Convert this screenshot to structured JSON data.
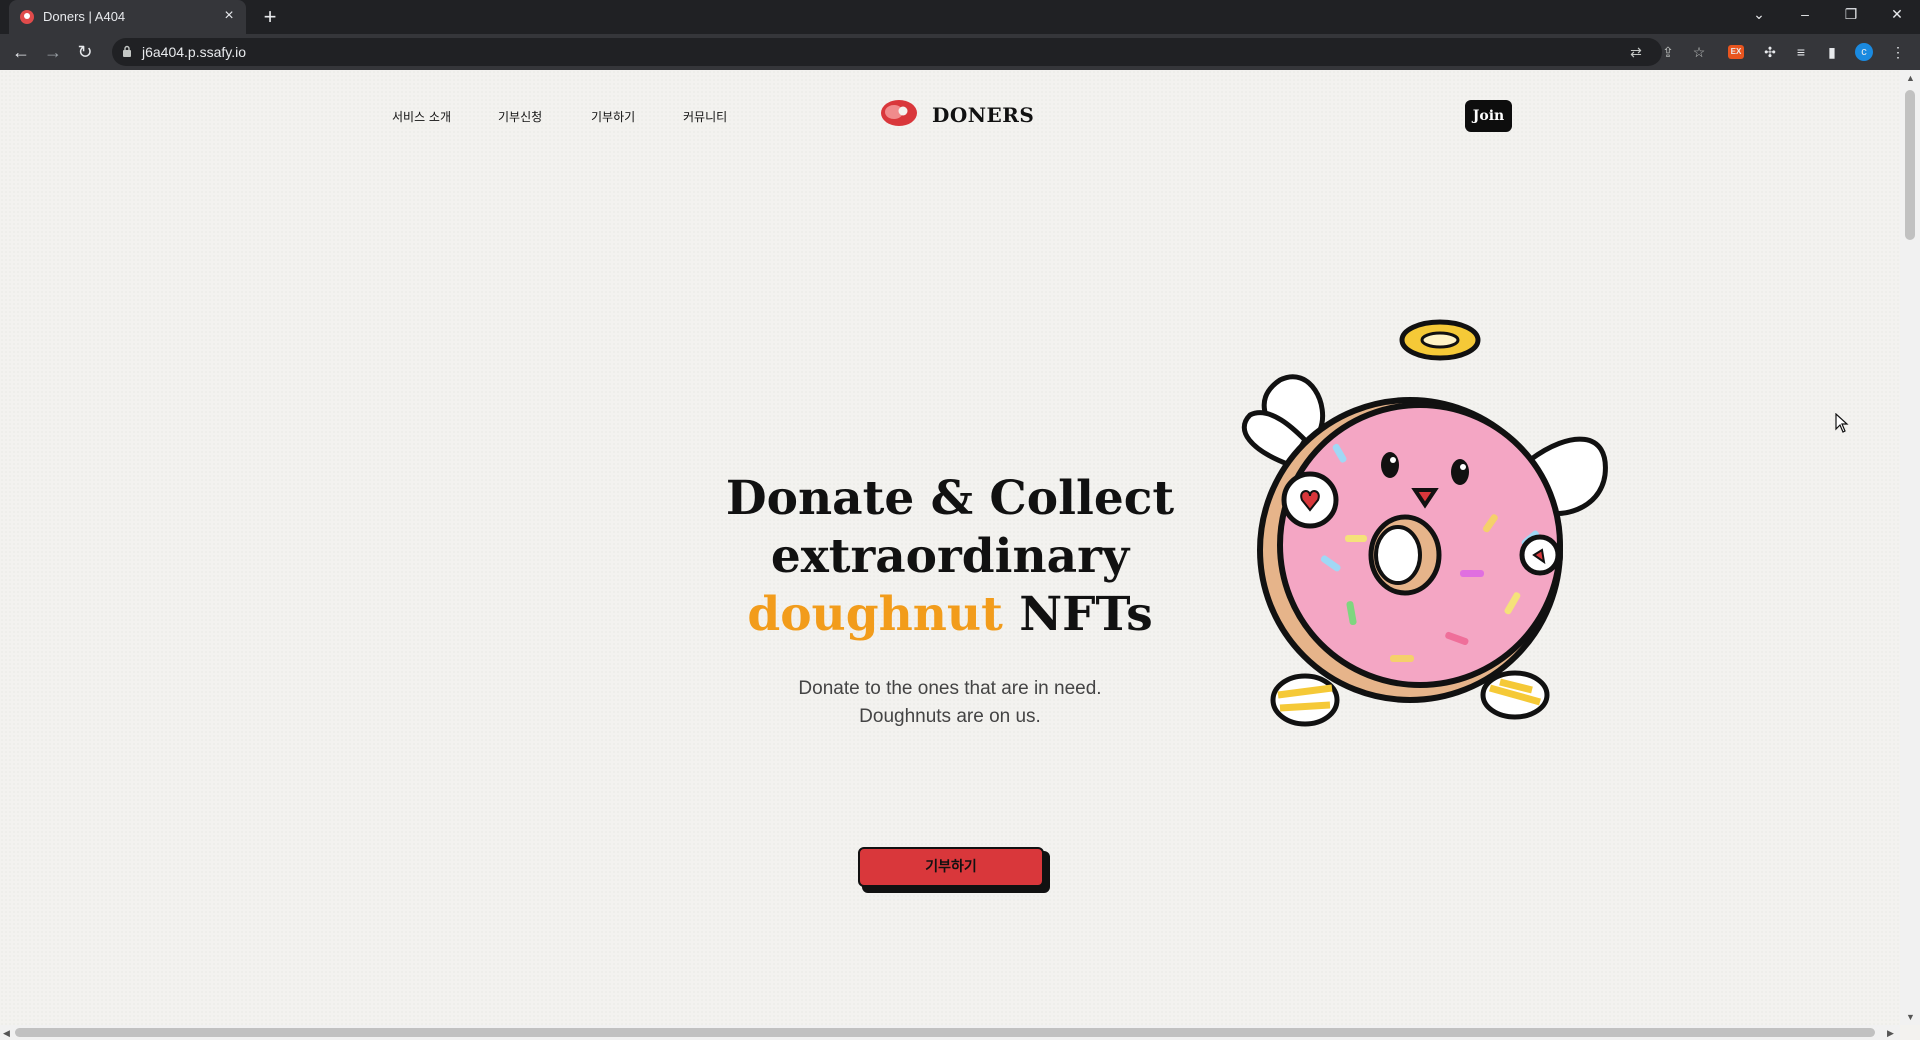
{
  "browser": {
    "tab_title": "Doners | A404",
    "url": "j6a404.p.ssafy.io",
    "profile_initial": "c",
    "ext_badge": "EX"
  },
  "nav": {
    "links": [
      "서비스 소개",
      "기부신청",
      "기부하기",
      "커뮤니티"
    ],
    "logo_text": "DONERS",
    "join_label": "Join"
  },
  "hero": {
    "title_line1": "Donate & Collect",
    "title_line2": "extraordinary",
    "title_accent": "doughnut",
    "title_rest": "NFTs",
    "subtitle_line1": "Donate to the ones that are in need.",
    "subtitle_line2": "Doughnuts are on us.",
    "cta_label": "기부하기"
  },
  "colors": {
    "accent": "#f29c1b",
    "cta": "#d9373b",
    "brand": "#d9373b",
    "donut_pink": "#f4a6c4"
  }
}
